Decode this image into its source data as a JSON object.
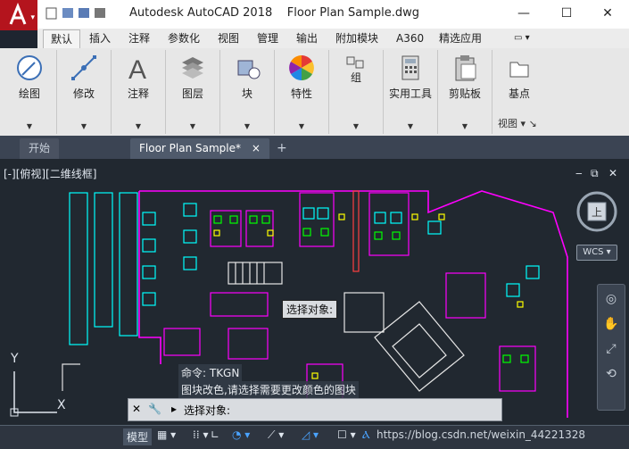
{
  "window": {
    "title": "Autodesk AutoCAD 2018    Floor Plan Sample.dwg",
    "minimize": "—",
    "maximize": "☐",
    "close": "✕"
  },
  "menu": {
    "tabs": [
      "默认",
      "插入",
      "注释",
      "参数化",
      "视图",
      "管理",
      "输出",
      "附加模块",
      "A360",
      "精选应用"
    ],
    "active": "默认"
  },
  "ribbon": {
    "panels": [
      {
        "label": "绘图",
        "icon": "pencil-circle-icon"
      },
      {
        "label": "修改",
        "icon": "modify-icon"
      },
      {
        "label": "注释",
        "icon": "text-a-icon"
      },
      {
        "label": "图层",
        "icon": "layers-icon"
      },
      {
        "label": "块",
        "icon": "block-icon"
      },
      {
        "label": "特性",
        "icon": "color-wheel-icon"
      },
      {
        "label": "组",
        "icon": "group-icon"
      },
      {
        "label": "实用工具",
        "icon": "calculator-icon"
      },
      {
        "label": "剪贴板",
        "icon": "clipboard-icon"
      },
      {
        "label": "基点",
        "icon": "base-point-icon"
      }
    ],
    "view_label": "视图"
  },
  "doc_tabs": {
    "start": "开始",
    "active": "Floor Plan Sample*",
    "close_icon": "×",
    "new_tab": "+"
  },
  "viewport": {
    "label": "[-][俯视][二维线框]",
    "compass_top": "上",
    "wcs": "WCS",
    "select_objects_popup": "选择对象:",
    "axis_y": "Y",
    "axis_x": "X"
  },
  "command": {
    "history_1": "命令: TKGN",
    "history_2": "图块改色,请选择需要更改颜色的图块",
    "prompt": "选择对象:"
  },
  "status": {
    "model": "模型",
    "watermark": "https://blog.csdn.net/weixin_44221328"
  },
  "colors": {
    "drawing_bg": "#212830",
    "magenta": "#ff00ff",
    "cyan": "#00ffff",
    "green": "#00ff00",
    "yellow": "#ffff00",
    "accent_red": "#b4141d"
  }
}
